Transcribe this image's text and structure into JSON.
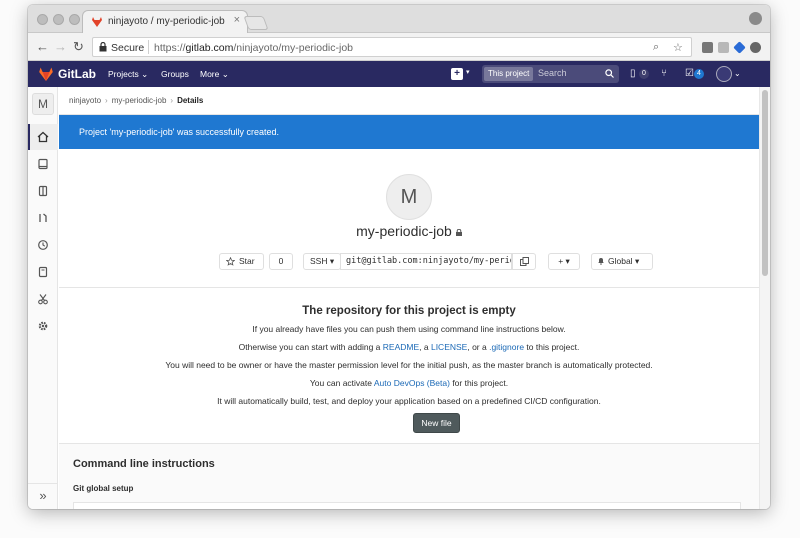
{
  "browser": {
    "tab_title": "ninjayoto / my-periodic-job · G",
    "tab_close": "×",
    "secure_label": "Secure",
    "url_prefix": "https://",
    "url_host": "gitlab.com",
    "url_path": "/ninjayoto/my-periodic-job"
  },
  "header": {
    "brand": "GitLab",
    "nav": [
      "Projects",
      "Groups",
      "More"
    ],
    "search_scope": "This project",
    "search_placeholder": "Search",
    "issues_count": "0",
    "todos_count": "4",
    "brand_color": "#292961"
  },
  "sidebar": {
    "project_initial": "M",
    "items": [
      "home-icon",
      "repository-icon",
      "issues-icon",
      "merge-requests-icon",
      "ci-cd-icon",
      "wiki-icon",
      "snippets-icon",
      "settings-icon"
    ],
    "collapse_label": "»"
  },
  "breadcrumb": {
    "items": [
      "ninjayoto",
      "my-periodic-job",
      "Details"
    ]
  },
  "flash": {
    "message": "Project 'my-periodic-job' was successfully created.",
    "color": "#1f78d1"
  },
  "project": {
    "avatar_initial": "M",
    "name": "my-periodic-job",
    "star_label": "Star",
    "star_count": "0",
    "protocol": "SSH",
    "clone_url": "git@gitlab.com:ninjayoto/my-periodic-job.git",
    "add_label": "+",
    "notification_label": "Global"
  },
  "empty_repo": {
    "title": "The repository for this project is empty",
    "line1": "If you already have files you can push them using command line instructions below.",
    "line2_prefix": "Otherwise you can start with adding a ",
    "readme": "README",
    "sep1": ", a ",
    "license": "LICENSE",
    "sep2": ", or a ",
    "gitignore": ".gitignore",
    "line2_suffix": " to this project.",
    "line3": "You will need to be owner or have the master permission level for the initial push, as the master branch is automatically protected.",
    "line4_prefix": "You can activate ",
    "autodevops": "Auto DevOps (Beta)",
    "line4_suffix": " for this project.",
    "line5": "It will automatically build, test, and deploy your application based on a predefined CI/CD configuration.",
    "new_file_label": "New file"
  },
  "cli": {
    "title": "Command line instructions",
    "subtitle": "Git global setup"
  }
}
